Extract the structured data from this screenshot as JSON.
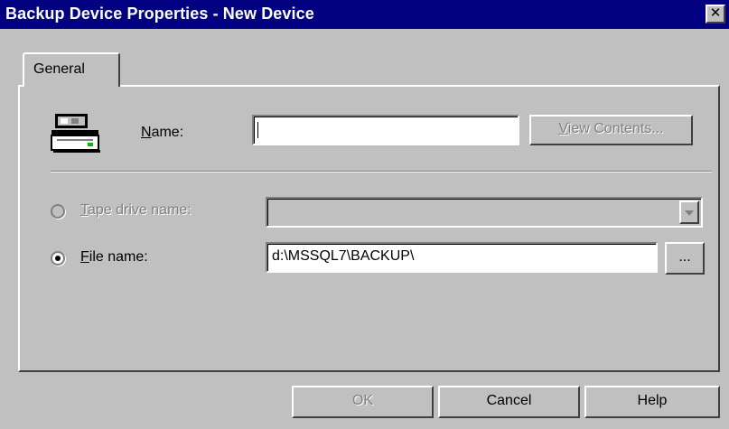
{
  "window": {
    "title": "Backup Device Properties - New Device",
    "close_glyph": "✕"
  },
  "tabs": [
    {
      "label": "General",
      "selected": true
    }
  ],
  "general": {
    "device_icon": "tape-drive-icon",
    "name": {
      "label": "Name:",
      "mnemonic": "N",
      "label_rest": "ame:",
      "value": ""
    },
    "view_contents_button": {
      "label": "View Contents...",
      "mnemonic": "V",
      "label_rest": "iew Contents...",
      "enabled": false
    },
    "tape_drive": {
      "label": "Tape drive name:",
      "mnemonic": "T",
      "label_rest": "ape drive name:",
      "selected": false,
      "enabled": false,
      "value": ""
    },
    "file_name": {
      "label": "File name:",
      "mnemonic": "F",
      "label_rest": "ile name:",
      "selected": true,
      "enabled": true,
      "value": "d:\\MSSQL7\\BACKUP\\"
    },
    "browse_button_label": "..."
  },
  "footer": {
    "ok_label": "OK",
    "ok_enabled": false,
    "cancel_label": "Cancel",
    "help_label": "Help"
  },
  "colors": {
    "titlebar": "#000080",
    "face": "#c0c0c0",
    "disabled_text": "#808080"
  }
}
